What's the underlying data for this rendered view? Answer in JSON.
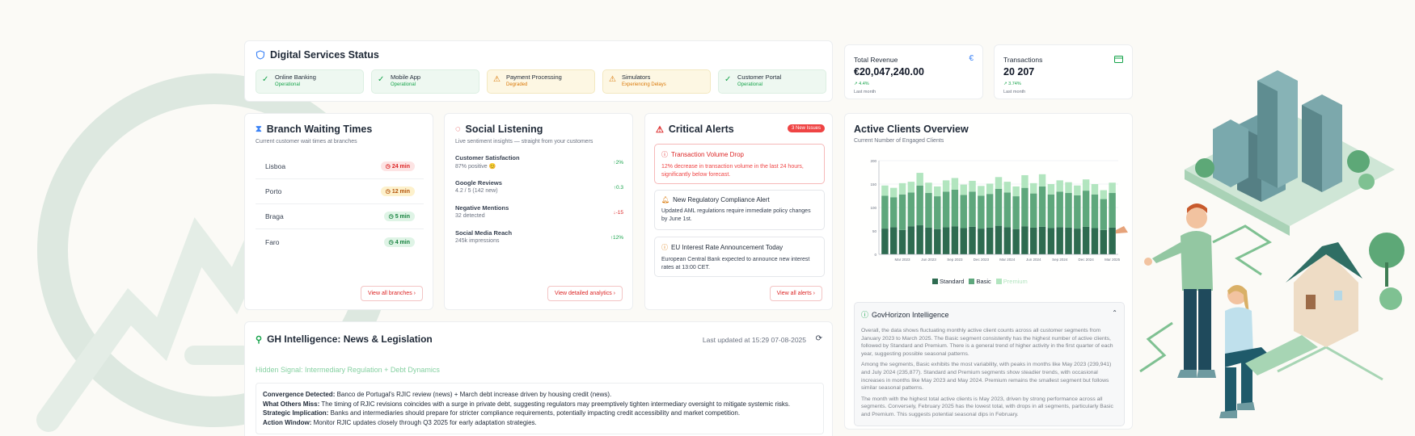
{
  "services": {
    "title": "Digital Services Status",
    "items": [
      {
        "name": "Online Banking",
        "status": "Operational",
        "state": "ok"
      },
      {
        "name": "Mobile App",
        "status": "Operational",
        "state": "ok"
      },
      {
        "name": "Payment Processing",
        "status": "Degraded",
        "state": "warn"
      },
      {
        "name": "Simulators",
        "status": "Experiencing Delays",
        "state": "warn"
      },
      {
        "name": "Customer Portal",
        "status": "Operational",
        "state": "ok"
      }
    ]
  },
  "kpis": {
    "revenue": {
      "label": "Total Revenue",
      "value": "€20,047,240.00",
      "change": "↗ 4.4%",
      "period": "Last month",
      "icon": "euro-icon"
    },
    "transactions": {
      "label": "Transactions",
      "value": "20 207",
      "change": "↗ 3.74%",
      "period": "Last month",
      "icon": "card-icon"
    }
  },
  "branch": {
    "title": "Branch Waiting Times",
    "subtitle": "Current customer wait times at branches",
    "rows": [
      {
        "name": "Lisboa",
        "wait": "24 min",
        "level": "red"
      },
      {
        "name": "Porto",
        "wait": "12 min",
        "level": "yellow"
      },
      {
        "name": "Braga",
        "wait": "5 min",
        "level": "green"
      },
      {
        "name": "Faro",
        "wait": "4 min",
        "level": "green"
      }
    ],
    "link": "View all branches"
  },
  "social": {
    "title": "Social Listening",
    "subtitle": "Live sentiment insights — straight from your customers",
    "items": [
      {
        "name": "Customer Satisfaction",
        "value": "87% positive 😊",
        "trend": "↑2%",
        "dir": "up"
      },
      {
        "name": "Google Reviews",
        "value": "4.2 / 5 (142 new)",
        "trend": "↑0.3",
        "dir": "up"
      },
      {
        "name": "Negative Mentions",
        "value": "32 detected",
        "trend": "↓-15",
        "dir": "down"
      },
      {
        "name": "Social Media Reach",
        "value": "245k impressions",
        "trend": "↑12%",
        "dir": "up"
      }
    ],
    "link": "View detailed analytics"
  },
  "alerts": {
    "title": "Critical Alerts",
    "badge": "3 New Issues",
    "items": [
      {
        "title": "Transaction Volume Drop",
        "desc": "12% decrease in transaction volume in the last 24 hours, significantly below forecast.",
        "kind": "danger"
      },
      {
        "title": "New Regulatory Compliance Alert",
        "desc": "Updated AML regulations require immediate policy changes by June 1st.",
        "kind": "plain"
      },
      {
        "title": "EU Interest Rate Announcement Today",
        "desc": "European Central Bank expected to announce new interest rates at 13:00 CET.",
        "kind": "plain"
      }
    ],
    "link": "View all alerts"
  },
  "clients": {
    "title": "Active Clients Overview",
    "subtitle": "Current Number of Engaged Clients"
  },
  "chart_data": {
    "type": "bar",
    "stacked": true,
    "title": "",
    "xlabel": "",
    "ylabel": "",
    "ylim": [
      0,
      200
    ],
    "yticks": [
      0,
      50,
      100,
      150,
      200
    ],
    "categories": [
      "Jan 2023",
      "Feb 2023",
      "Mar 2023",
      "Apr 2023",
      "May 2023",
      "Jun 2023",
      "Jul 2023",
      "Aug 2023",
      "Sep 2023",
      "Oct 2023",
      "Nov 2023",
      "Dec 2023",
      "Jan 2024",
      "Feb 2024",
      "Mar 2024",
      "Apr 2024",
      "May 2024",
      "Jun 2024",
      "Jul 2024",
      "Aug 2024",
      "Sep 2024",
      "Oct 2024",
      "Nov 2024",
      "Dec 2024",
      "Jan 2025",
      "Feb 2025",
      "Mar 2025"
    ],
    "tick_labels": [
      "Mar 2023",
      "Jun 2023",
      "Sep 2023",
      "Dec 2023",
      "Mar 2024",
      "Jun 2024",
      "Sep 2024",
      "Dec 2024",
      "Mar 2025"
    ],
    "series": [
      {
        "name": "Standard",
        "color": "#2e6b50",
        "values": [
          55,
          58,
          52,
          60,
          62,
          57,
          54,
          58,
          60,
          56,
          59,
          55,
          57,
          61,
          58,
          54,
          60,
          57,
          59,
          56,
          58,
          57,
          55,
          59,
          56,
          52,
          57
        ]
      },
      {
        "name": "Basic",
        "color": "#5ea77c",
        "values": [
          70,
          64,
          76,
          72,
          85,
          74,
          70,
          76,
          78,
          71,
          75,
          70,
          72,
          79,
          74,
          70,
          82,
          73,
          86,
          72,
          76,
          74,
          71,
          77,
          72,
          66,
          74
        ]
      },
      {
        "name": "Premium",
        "color": "#b2e5bf",
        "values": [
          22,
          20,
          24,
          23,
          27,
          22,
          21,
          24,
          25,
          22,
          23,
          21,
          22,
          25,
          23,
          21,
          27,
          22,
          26,
          22,
          24,
          23,
          21,
          24,
          22,
          19,
          22
        ]
      }
    ]
  },
  "intel": {
    "title": "GovHorizon Intelligence",
    "paragraphs": [
      "Overall, the data shows fluctuating monthly active client counts across all customer segments from January 2023 to March 2025. The Basic segment consistently has the highest number of active clients, followed by Standard and Premium. There is a general trend of higher activity in the first quarter of each year, suggesting possible seasonal patterns.",
      "Among the segments, Basic exhibits the most variability, with peaks in months like May 2023 (239,941) and July 2024 (235,877). Standard and Premium segments show steadier trends, with occasional increases in months like May 2023 and May 2024. Premium remains the smallest segment but follows similar seasonal patterns.",
      "The month with the highest total active clients is May 2023, driven by strong performance across all segments. Conversely, February 2025 has the lowest total, with drops in all segments, particularly Basic and Premium. This suggests potential seasonal dips in February."
    ]
  },
  "gh": {
    "title": "GH Intelligence: News & Legislation",
    "updated": "Last updated at 15:29 07-08-2025",
    "signal": "Hidden Signal: Intermediary Regulation + Debt Dynamics",
    "lines": [
      {
        "label": "Convergence Detected:",
        "text": " Banco de Portugal's RJIC review (news) + March debt increase driven by housing credit (news)."
      },
      {
        "label": "What Others Miss:",
        "text": " The timing of RJIC revisions coincides with a surge in private debt, suggesting regulators may preemptively tighten intermediary oversight to mitigate systemic risks."
      },
      {
        "label": "Strategic Implication:",
        "text": " Banks and intermediaries should prepare for stricter compliance requirements, potentially impacting credit accessibility and market competition."
      },
      {
        "label": "Action Window:",
        "text": " Monitor RJIC updates closely through Q3 2025 for early adaptation strategies."
      }
    ]
  },
  "colors": {
    "accent_red": "#dc2626",
    "ok_green": "#16a34a",
    "warn_amber": "#d97706",
    "brand_teal": "#4f7f86"
  }
}
